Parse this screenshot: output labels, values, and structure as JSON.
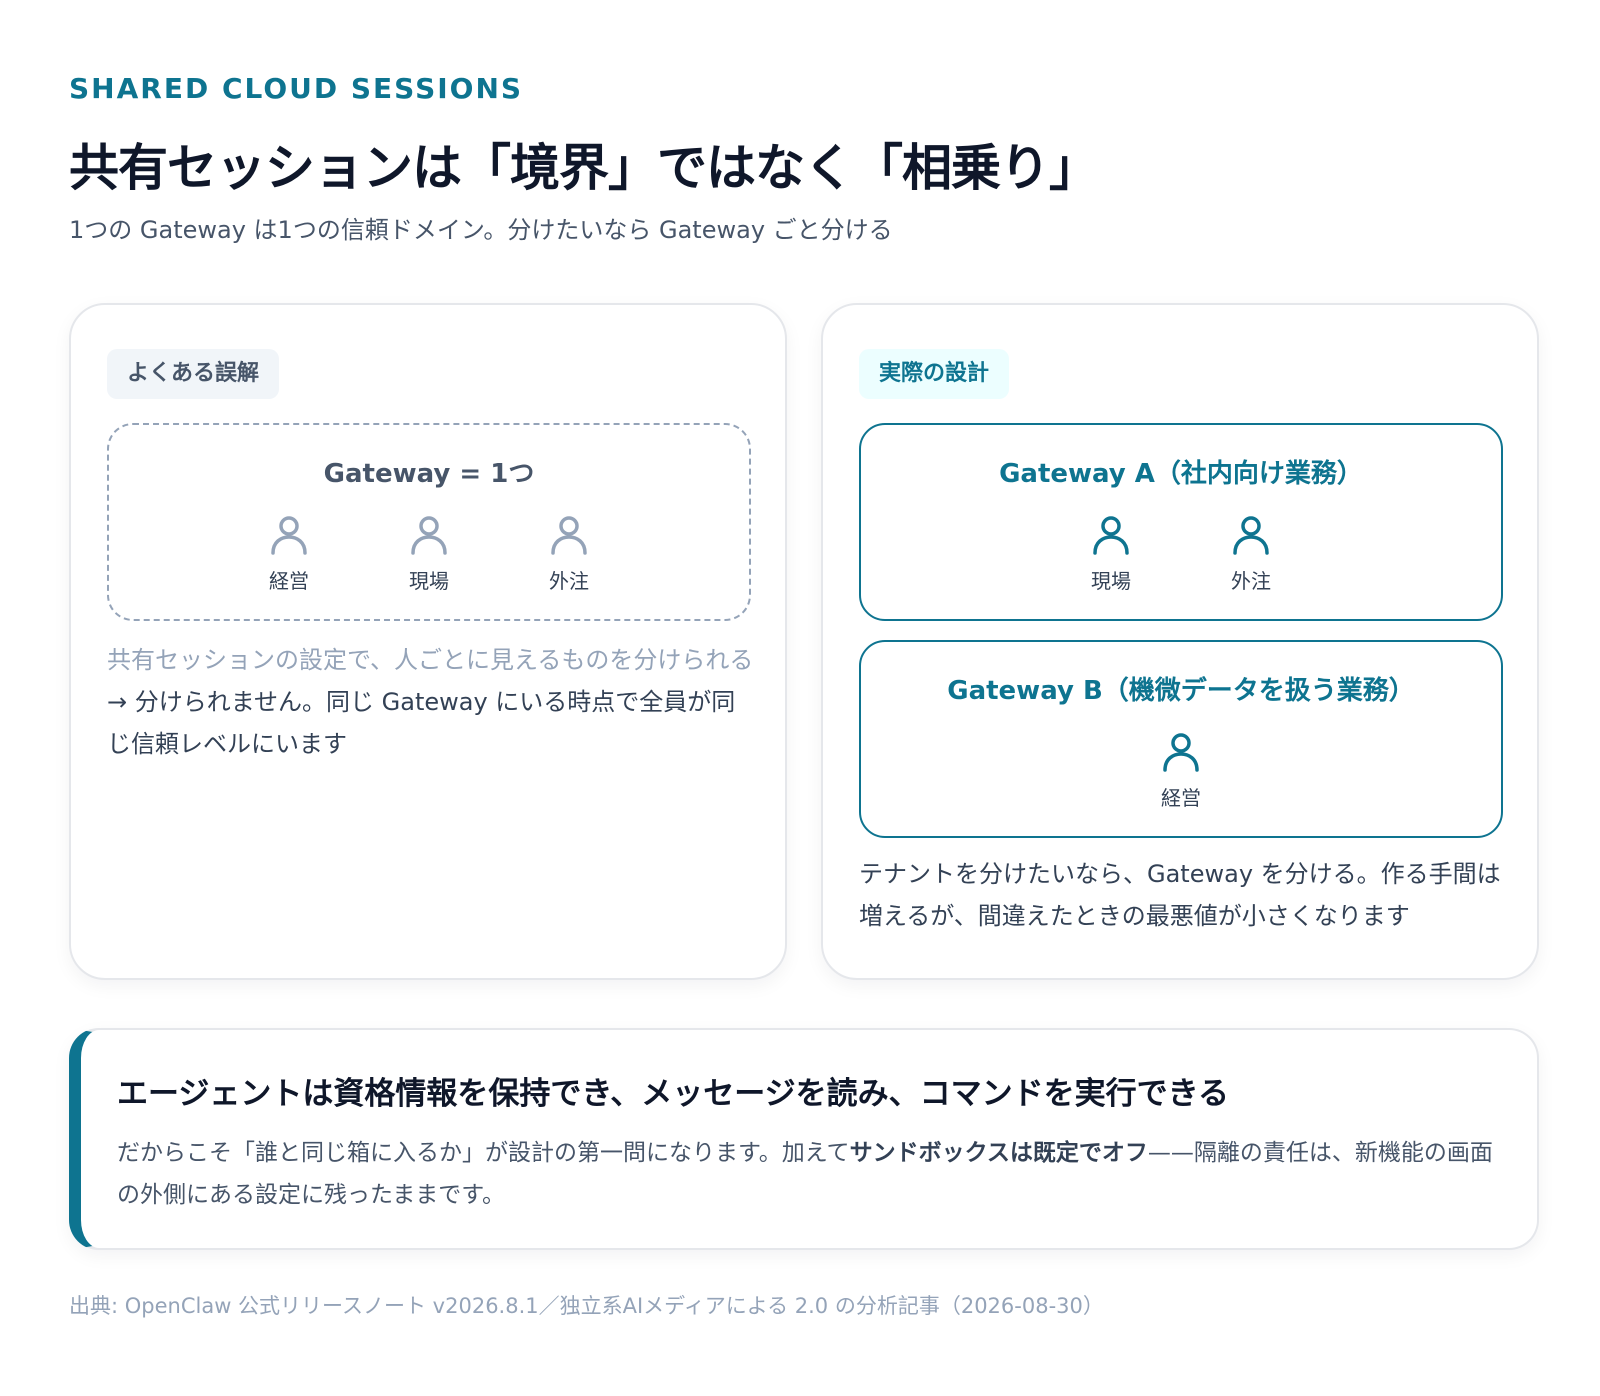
{
  "header": {
    "eyebrow": "SHARED CLOUD SESSIONS",
    "title": "共有セッションは「境界」ではなく「相乗り」",
    "subtitle": "1つの Gateway は1つの信頼ドメイン。分けたいなら Gateway ごと分ける"
  },
  "misconception": {
    "tag": "よくある誤解",
    "gateway_title": "Gateway = 1つ",
    "people": [
      {
        "label": "経営",
        "icon": "person-icon"
      },
      {
        "label": "現場",
        "icon": "person-icon"
      },
      {
        "label": "外注",
        "icon": "person-icon"
      }
    ],
    "note_muted": "共有セッションの設定で、人ごとに見えるものを分けられる",
    "note_main": "→ 分けられません。同じ Gateway にいる時点で全員が同じ信頼レベルにいます"
  },
  "design": {
    "tag": "実際の設計",
    "gateway_a": {
      "title": "Gateway A（社内向け業務）",
      "people": [
        {
          "label": "現場",
          "icon": "person-icon"
        },
        {
          "label": "外注",
          "icon": "person-icon"
        }
      ]
    },
    "gateway_b": {
      "title": "Gateway B（機微データを扱う業務）",
      "people": [
        {
          "label": "経営",
          "icon": "person-icon"
        }
      ]
    },
    "note": "テナントを分けたいなら、Gateway を分ける。作る手間は増えるが、間違えたときの最悪値が小さくなります"
  },
  "callout": {
    "title": "エージェントは資格情報を保持でき、メッセージを読み、コマンドを実行できる",
    "body_pre": "だからこそ「誰と同じ箱に入るか」が設計の第一問になります。加えて",
    "body_bold": "サンドボックスは既定でオフ",
    "body_post": "——隔離の責任は、新機能の画面の外側にある設定に残ったままです。"
  },
  "source": "出典: OpenClaw 公式リリースノート v2026.8.1／独立系AIメディアによる 2.0 の分析記事（2026-08-30）",
  "colors": {
    "accent": "#0e7490",
    "muted": "#94a3b8",
    "text": "#0f172a"
  }
}
